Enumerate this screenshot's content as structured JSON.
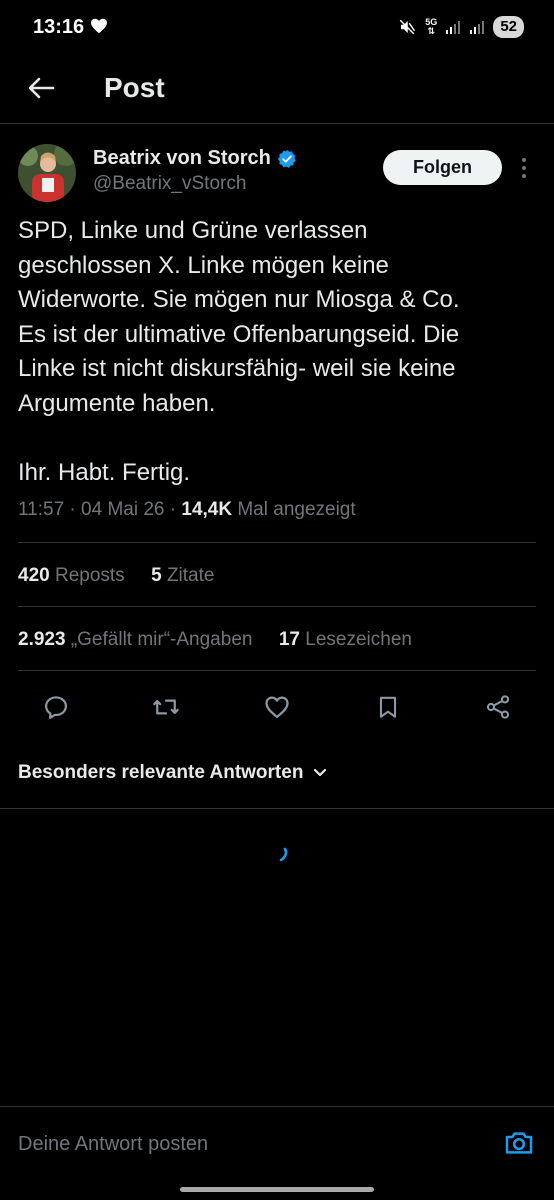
{
  "status_bar": {
    "time": "13:16",
    "battery": "52",
    "network": "5G"
  },
  "header": {
    "title": "Post"
  },
  "author": {
    "name": "Beatrix von Storch",
    "handle": "@Beatrix_vStorch",
    "verified_color": "#1d9bf0",
    "follow_label": "Folgen"
  },
  "post": {
    "lines": [
      "SPD, Linke und Grüne verlassen",
      "geschlossen X. Linke mögen keine",
      "Widerworte. Sie mögen nur Miosga & Co.",
      "Es ist der ultimative Offenbarungseid. Die",
      "Linke ist nicht diskursfähig- weil sie keine",
      "Argumente haben."
    ],
    "closing_line": "Ihr. Habt. Fertig.",
    "time": "11:57",
    "date": "04 Mai 26",
    "views_count": "14,4K",
    "views_label": "Mal angezeigt"
  },
  "stats": {
    "reposts_count": "420",
    "reposts_label": "Reposts",
    "quotes_count": "5",
    "quotes_label": "Zitate",
    "likes_count": "2.923",
    "likes_label": "„Gefällt mir“-Angaben",
    "bookmarks_count": "17",
    "bookmarks_label": "Lesezeichen"
  },
  "actions": [
    "reply-icon",
    "repost-icon",
    "like-icon",
    "bookmark-icon",
    "share-icon"
  ],
  "replies": {
    "sort_label": "Besonders relevante Antworten"
  },
  "reply_bar": {
    "placeholder": "Deine Antwort posten"
  },
  "colors": {
    "accent": "#1d9bf0",
    "background": "#000000",
    "secondary_text": "#71767b"
  }
}
